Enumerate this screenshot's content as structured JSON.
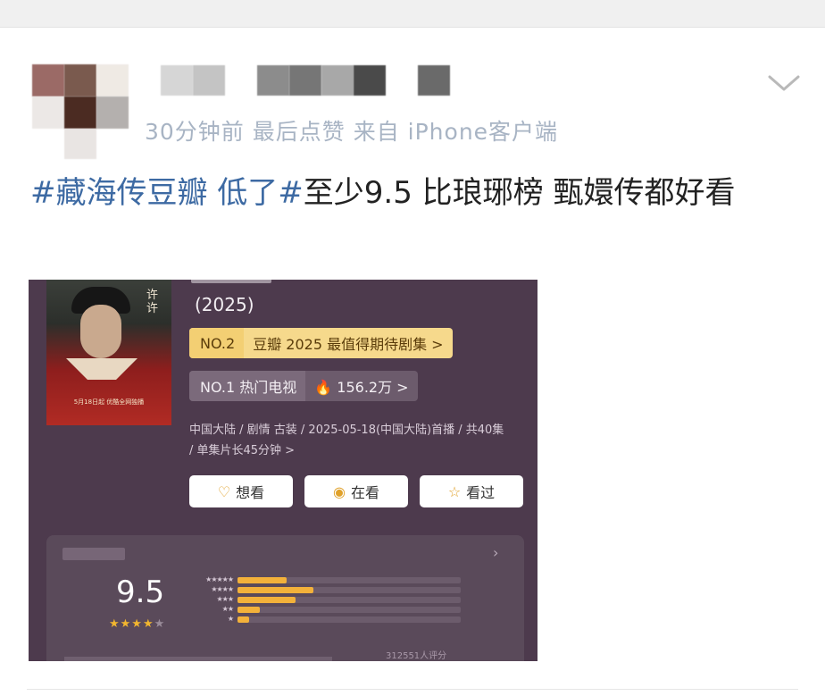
{
  "post": {
    "meta_text": "30分钟前 最后点赞 来自 iPhone客户端",
    "hashtag": "#藏海传豆瓣 低了#",
    "body": "至少9.5 比琅琊榜 甄嬛传都好看"
  },
  "icons": {
    "collapse": "chevron-down-icon"
  },
  "screenshot": {
    "poster_vertical_text": "许许",
    "poster_caption": "5月18日起 优酷全网独播",
    "year": "(2025)",
    "rank1_no": "NO.2",
    "rank1_text": "豆瓣 2025 最值得期待剧集 >",
    "rank2_no": "NO.1 热门电视",
    "rank2_text": "🔥 156.2万 >",
    "info": "中国大陆 / 剧情 古装 / 2025-05-18(中国大陆)首播 / 共40集 / 单集片长45分钟 >",
    "buttons": [
      {
        "icon": "♡",
        "label": "想看"
      },
      {
        "icon": "◉",
        "label": "在看"
      },
      {
        "icon": "☆",
        "label": "看过"
      }
    ],
    "score": "9.5",
    "stars": "★★★★",
    "stars_half": "★",
    "star_rows": [
      "★★★★★",
      "★★★★",
      "★★★",
      "★★",
      "★"
    ],
    "star_distribution": [
      0.22,
      0.34,
      0.26,
      0.1,
      0.05
    ],
    "rating_count": "312551人评分"
  },
  "colors": {
    "hashtag": "#3d6aa3",
    "accent": "#f3b13a",
    "panel": "#4d3a4d"
  }
}
